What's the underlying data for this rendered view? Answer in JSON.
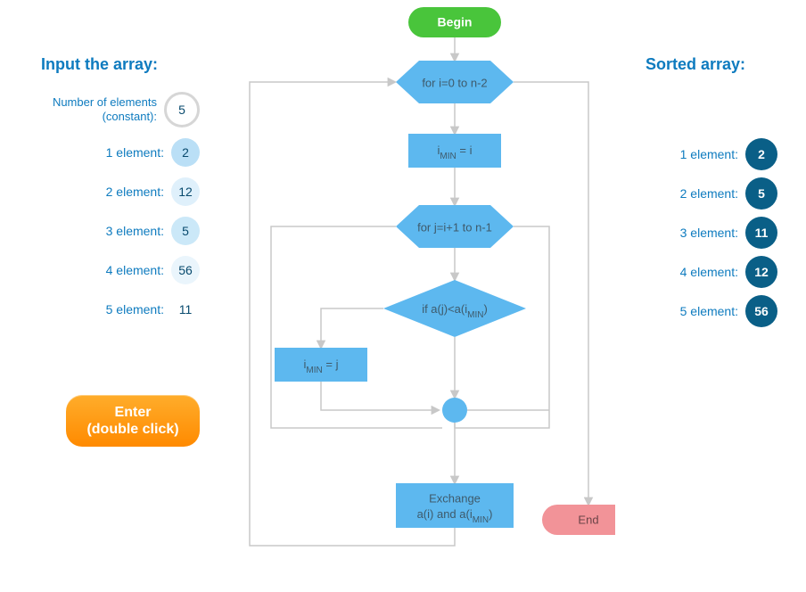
{
  "left": {
    "title": "Input the array:",
    "constant_label_line1": "Number of elements",
    "constant_label_line2": "(constant):",
    "constant_value": "5",
    "elements": [
      {
        "label": "1 element:",
        "value": "2"
      },
      {
        "label": "2 element:",
        "value": "12"
      },
      {
        "label": "3 element:",
        "value": "5"
      },
      {
        "label": "4 element:",
        "value": "56"
      },
      {
        "label": "5 element:",
        "value": "11"
      }
    ]
  },
  "enter_button": {
    "line1": "Enter",
    "line2": "(double click)"
  },
  "right": {
    "title": "Sorted array:",
    "elements": [
      {
        "label": "1 element:",
        "value": "2"
      },
      {
        "label": "2 element:",
        "value": "5"
      },
      {
        "label": "3 element:",
        "value": "11"
      },
      {
        "label": "4 element:",
        "value": "12"
      },
      {
        "label": "5 element:",
        "value": "56"
      }
    ]
  },
  "flow": {
    "begin": "Begin",
    "for_i": "for i=0 to n-2",
    "imin_i_pre": "i",
    "imin_i_sub": "MIN",
    "imin_i_post": " = i",
    "for_j": "for j=i+1 to n-1",
    "cond_pre": "if a(j)<a(i",
    "cond_sub": "MIN",
    "cond_post": ")",
    "imin_j_pre": "i",
    "imin_j_sub": "MIN",
    "imin_j_post": " = j",
    "exch_line1": "Exchange",
    "exch_line2_pre": "a(i) and a(i",
    "exch_line2_sub": "MIN",
    "exch_line2_post": ")",
    "end": "End"
  },
  "colors": {
    "begin": "#49c53b",
    "end": "#f29398",
    "node": "#5db8ef",
    "accent": "#0e7bbf",
    "sorted": "#0a5f87",
    "button_top": "#ffad2b",
    "button_bottom": "#ff8a00"
  }
}
